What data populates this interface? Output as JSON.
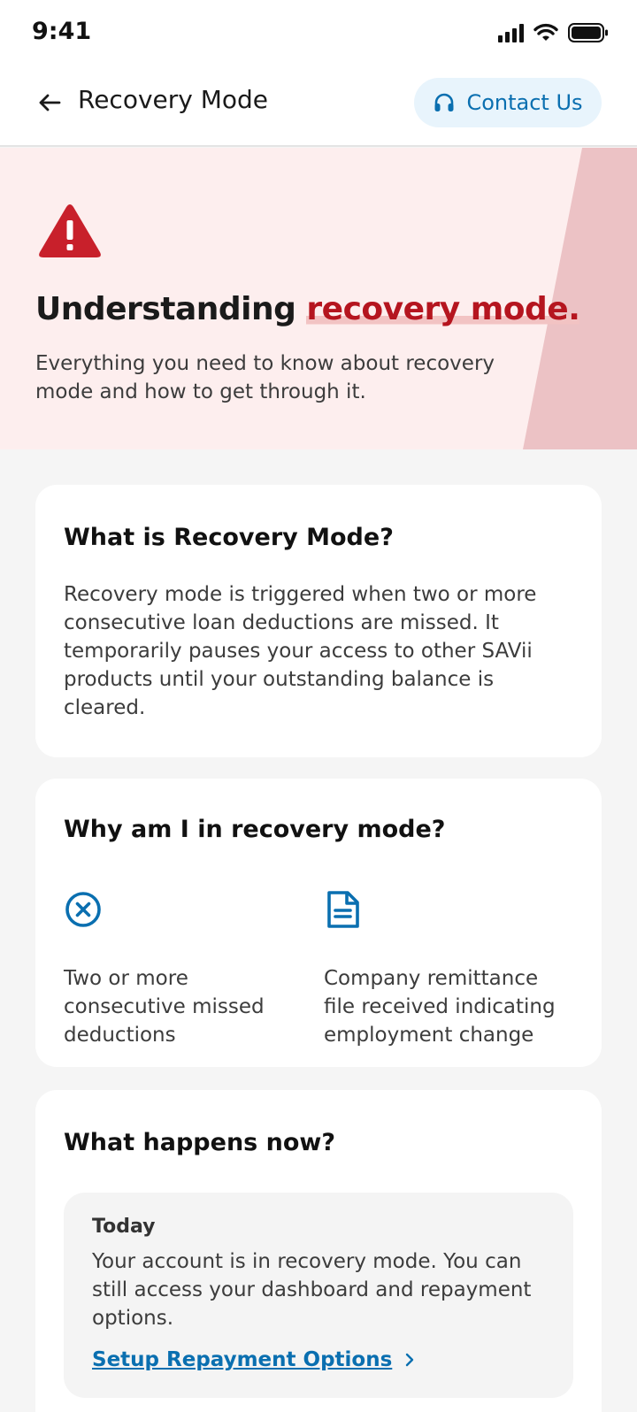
{
  "status_bar": {
    "time": "9:41"
  },
  "header": {
    "title": "Recovery Mode",
    "contact_label": "Contact Us"
  },
  "hero": {
    "title_prefix": "Understanding ",
    "title_accent": "recovery mode.",
    "subtitle": "Everything you need to know about recovery mode and how to get through it."
  },
  "what_is": {
    "title": "What is Recovery Mode?",
    "body": "Recovery mode is triggered when two or more consecutive loan deductions are missed. It temporarily pauses your access to other SAVii products until your outstanding balance is cleared."
  },
  "why": {
    "title": "Why am I in recovery mode?",
    "reasons": [
      {
        "icon": "x-circle-icon",
        "text": "Two or more consecutive missed deductions"
      },
      {
        "icon": "document-icon",
        "text": "Company remittance file received indicating employment change"
      }
    ]
  },
  "what_now": {
    "title": "What happens now?",
    "steps": [
      {
        "label": "Today",
        "text": "Your account is in recovery mode. You can still access your dashboard and repayment options.",
        "link_label": "Setup Repayment Options"
      }
    ]
  },
  "colors": {
    "accent_red": "#b5151f",
    "link_blue": "#0a6fb0",
    "hero_bg": "#fdeeee",
    "hero_slant": "#ecc2c5"
  }
}
